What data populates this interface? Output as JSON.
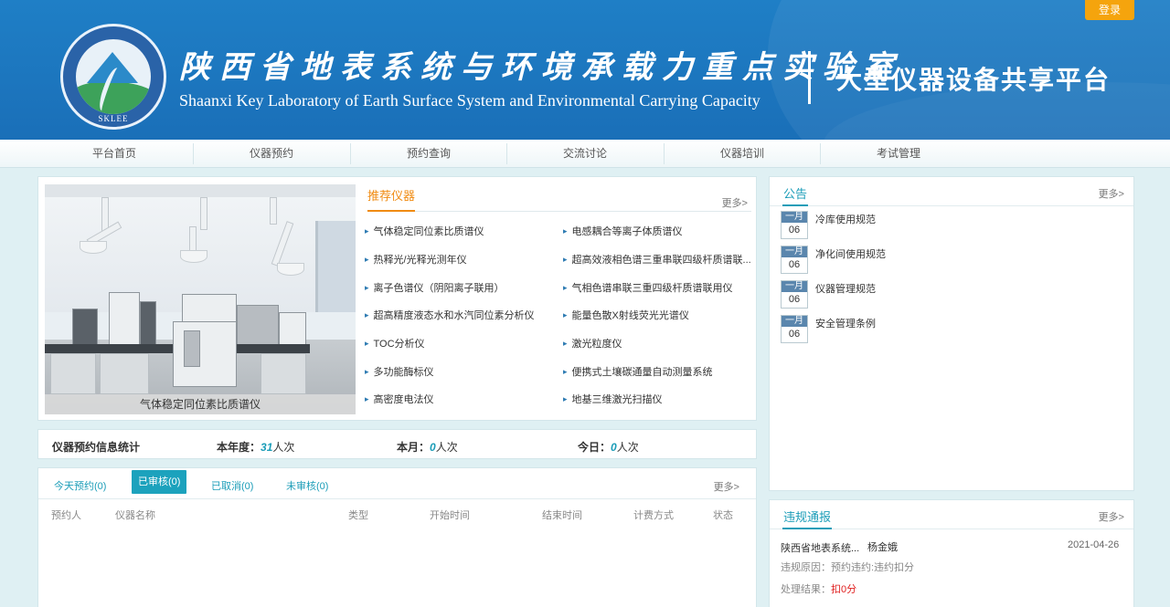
{
  "header": {
    "title_cn": "陕西省地表系统与环境承载力重点实验室",
    "title_en": "Shaanxi Key Laboratory of Earth Surface System and Environmental Carrying Capacity",
    "platform": "大型仪器设备共享平台",
    "logo_abbr": "SKLEE",
    "login_label": "登录"
  },
  "nav": {
    "items": [
      "平台首页",
      "仪器预约",
      "预约查询",
      "交流讨论",
      "仪器培训",
      "考试管理"
    ]
  },
  "recommend": {
    "title": "推荐仪器",
    "more": "更多>",
    "photo_caption": "气体稳定同位素比质谱仪",
    "left": [
      "气体稳定同位素比质谱仪",
      "热释光/光释光测年仪",
      "离子色谱仪（阴阳离子联用）",
      "超高精度液态水和水汽同位素分析仪",
      "TOC分析仪",
      "多功能酶标仪",
      "高密度电法仪"
    ],
    "right": [
      "电感耦合等离子体质谱仪",
      "超高效液相色谱三重串联四级杆质谱联...",
      "气相色谱串联三重四级杆质谱联用仪",
      "能量色散X射线荧光光谱仪",
      "激光粒度仪",
      "便携式土壤碳通量自动测量系统",
      "地基三维激光扫描仪"
    ]
  },
  "stats": {
    "title": "仪器预约信息统计",
    "year_label": "本年度：",
    "year_value": "31",
    "month_label": "本月：",
    "month_value": "0",
    "today_label": "今日：",
    "today_value": "0",
    "unit": "人次"
  },
  "booking": {
    "tabs": [
      "今天预约(0)",
      "已审核(0)",
      "已取消(0)",
      "未审核(0)"
    ],
    "active_tab": 1,
    "more": "更多>",
    "columns": [
      "预约人",
      "仪器名称",
      "类型",
      "开始时间",
      "结束时间",
      "计费方式",
      "状态"
    ]
  },
  "notice": {
    "title": "公告",
    "more": "更多>",
    "items": [
      {
        "month": "一月",
        "day": "06",
        "text": "冷库使用规范"
      },
      {
        "month": "一月",
        "day": "06",
        "text": "净化间使用规范"
      },
      {
        "month": "一月",
        "day": "06",
        "text": "仪器管理规范"
      },
      {
        "month": "一月",
        "day": "06",
        "text": "安全管理条例"
      }
    ]
  },
  "violation": {
    "title": "违规通报",
    "more": "更多>",
    "org": "陕西省地表系统...",
    "person": "杨金娥",
    "date": "2021-04-26",
    "reason_label": "违规原因：",
    "reason": "预约违约:违约扣分",
    "result_label": "处理结果：",
    "result": "扣0分"
  },
  "colors": {
    "header_bg": "#1a6fb8",
    "accent": "#1ca2bd",
    "orange": "#f08b12",
    "login": "#f5a40d",
    "penalty": "#e02020"
  }
}
